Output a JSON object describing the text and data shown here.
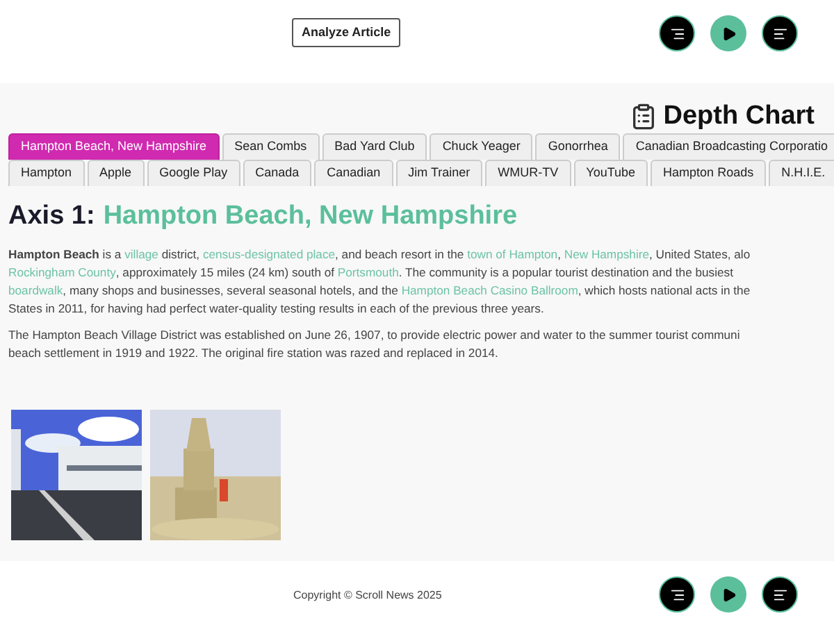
{
  "header": {
    "analyze_button": "Analyze Article",
    "controls": [
      {
        "kind": "right"
      },
      {
        "kind": "play"
      },
      {
        "kind": "left"
      }
    ]
  },
  "depth_chart": {
    "title": "Depth Chart",
    "tab_rows": [
      [
        {
          "label": "Hampton Beach, New Hampshire",
          "selected": true
        },
        {
          "label": "Sean Combs",
          "selected": false
        },
        {
          "label": "Bad Yard Club",
          "selected": false
        },
        {
          "label": "Chuck Yeager",
          "selected": false
        },
        {
          "label": "Gonorrhea",
          "selected": false
        },
        {
          "label": "Canadian Broadcasting Corporatio",
          "selected": false
        }
      ],
      [
        {
          "label": "Hampton",
          "selected": false
        },
        {
          "label": "Apple",
          "selected": false
        },
        {
          "label": "Google Play",
          "selected": false
        },
        {
          "label": "Canada",
          "selected": false
        },
        {
          "label": "Canadian",
          "selected": false
        },
        {
          "label": "Jim Trainer",
          "selected": false
        },
        {
          "label": "WMUR-TV",
          "selected": false
        },
        {
          "label": "YouTube",
          "selected": false
        },
        {
          "label": "Hampton Roads",
          "selected": false
        },
        {
          "label": "N.H.I.E.",
          "selected": false
        }
      ]
    ]
  },
  "article": {
    "axis_label": "Axis 1:",
    "heading": "Hampton Beach, New Hampshire",
    "paragraphs": [
      [
        [
          {
            "before": "**Hampton Beach** is a ",
            "link": "village"
          },
          {
            "before": " district, ",
            "link": "census-designated place"
          },
          {
            "before": ", and beach resort in the ",
            "link": "town of Hampton"
          },
          {
            "before": ", ",
            "link": "New Hampshire"
          },
          {
            "before": ", United States, alo"
          }
        ],
        [
          {
            "link": "Rockingham County"
          },
          {
            "before": ", approximately 15 miles (24 km) south of ",
            "link": "Portsmouth"
          },
          {
            "before": ". The community is a popular tourist destination and the busiest"
          }
        ],
        [
          {
            "link": "boardwalk"
          },
          {
            "before": ", many shops and businesses, several seasonal hotels, and the ",
            "link": "Hampton Beach Casino Ballroom"
          },
          {
            "before": ", which hosts national acts in the"
          }
        ],
        [
          {
            "before": "States in 2011, for having had perfect water-quality testing results in each of the previous three years."
          }
        ]
      ],
      [
        [
          {
            "before": "The Hampton Beach Village District was established on June 26, 1907, to provide electric power and water to the summer tourist communi"
          }
        ],
        [
          {
            "before": "beach settlement in 1919 and 1922. The original fire station was razed and replaced in 2014."
          }
        ]
      ]
    ],
    "images": [
      {
        "kind": "picture"
      },
      {
        "kind": "picture"
      }
    ]
  },
  "footer": {
    "copyright": "Copyright © Scroll News 2025",
    "controls": [
      {
        "kind": "right"
      },
      {
        "kind": "play"
      },
      {
        "kind": "left"
      }
    ]
  }
}
